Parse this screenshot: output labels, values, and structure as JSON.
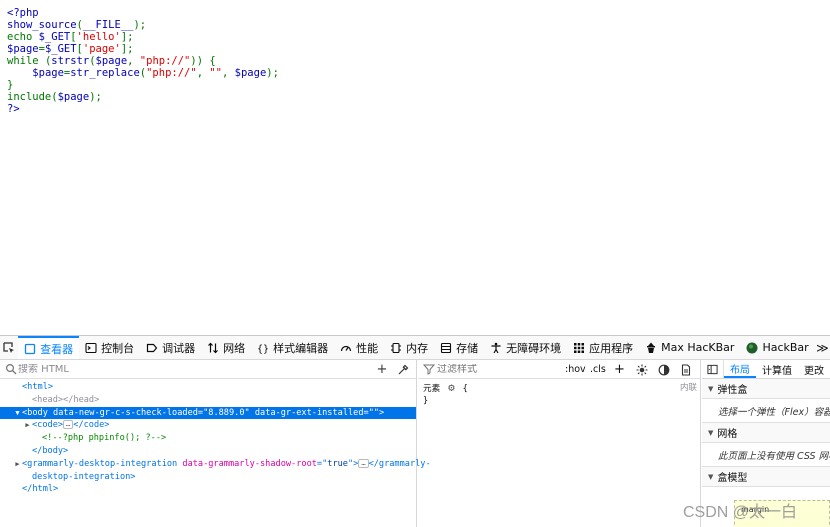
{
  "source": {
    "lines": [
      [
        {
          "t": "<?php",
          "c": "tag"
        }
      ],
      [
        {
          "t": "show_source",
          "c": "plain"
        },
        {
          "t": "(",
          "c": "op"
        },
        {
          "t": "__FILE__",
          "c": "plain"
        },
        {
          "t": ");",
          "c": "op"
        }
      ],
      [
        {
          "t": "echo ",
          "c": "op"
        },
        {
          "t": "$_GET",
          "c": "plain"
        },
        {
          "t": "[",
          "c": "op"
        },
        {
          "t": "'hello'",
          "c": "str"
        },
        {
          "t": "];",
          "c": "op"
        }
      ],
      [
        {
          "t": "$page",
          "c": "plain"
        },
        {
          "t": "=",
          "c": "op"
        },
        {
          "t": "$_GET",
          "c": "plain"
        },
        {
          "t": "[",
          "c": "op"
        },
        {
          "t": "'page'",
          "c": "str"
        },
        {
          "t": "];",
          "c": "op"
        }
      ],
      [
        {
          "t": "while ",
          "c": "op"
        },
        {
          "t": "(",
          "c": "op"
        },
        {
          "t": "strstr",
          "c": "plain"
        },
        {
          "t": "(",
          "c": "op"
        },
        {
          "t": "$page",
          "c": "plain"
        },
        {
          "t": ", ",
          "c": "op"
        },
        {
          "t": "\"php://\"",
          "c": "str"
        },
        {
          "t": ")) {",
          "c": "op"
        }
      ],
      [
        {
          "t": "    ",
          "c": "plain"
        },
        {
          "t": "$page",
          "c": "plain"
        },
        {
          "t": "=",
          "c": "op"
        },
        {
          "t": "str_replace",
          "c": "plain"
        },
        {
          "t": "(",
          "c": "op"
        },
        {
          "t": "\"php://\"",
          "c": "str"
        },
        {
          "t": ", ",
          "c": "op"
        },
        {
          "t": "\"\"",
          "c": "str"
        },
        {
          "t": ", ",
          "c": "op"
        },
        {
          "t": "$page",
          "c": "plain"
        },
        {
          "t": ");",
          "c": "op"
        }
      ],
      [
        {
          "t": "}",
          "c": "op"
        }
      ],
      [
        {
          "t": "include",
          "c": "op"
        },
        {
          "t": "(",
          "c": "op"
        },
        {
          "t": "$page",
          "c": "plain"
        },
        {
          "t": ");",
          "c": "op"
        }
      ],
      [
        {
          "t": "?>",
          "c": "tag"
        }
      ]
    ]
  },
  "toolbar": {
    "tabs": [
      {
        "id": "inspector",
        "label": "查看器",
        "icon": "inspector-icon",
        "active": true
      },
      {
        "id": "console",
        "label": "控制台",
        "icon": "console-icon"
      },
      {
        "id": "debugger",
        "label": "调试器",
        "icon": "debugger-icon"
      },
      {
        "id": "network",
        "label": "网络",
        "icon": "network-icon"
      },
      {
        "id": "style-editor",
        "label": "样式编辑器",
        "icon": "braces-icon"
      },
      {
        "id": "performance",
        "label": "性能",
        "icon": "gauge-icon"
      },
      {
        "id": "memory",
        "label": "内存",
        "icon": "memory-chip-icon"
      },
      {
        "id": "storage",
        "label": "存储",
        "icon": "storage-icon"
      },
      {
        "id": "accessibility",
        "label": "无障碍环境",
        "icon": "accessibility-icon"
      },
      {
        "id": "application",
        "label": "应用程序",
        "icon": "grid-icon"
      },
      {
        "id": "max-hackbar",
        "label": "Max HacKBar",
        "icon": "hacker-icon"
      },
      {
        "id": "hackbar",
        "label": "HackBar",
        "icon": "green-circle-icon"
      }
    ],
    "more_label": "≫"
  },
  "markup": {
    "search_placeholder": "搜索 HTML",
    "add_label": "+",
    "lines": [
      {
        "indent": 1,
        "twisty": "",
        "parts": [
          {
            "t": "<html>",
            "c": "tg"
          }
        ]
      },
      {
        "indent": 2,
        "twisty": "",
        "parts": [
          {
            "t": "<head>",
            "c": "dim"
          },
          {
            "t": "</head>",
            "c": "dim"
          }
        ]
      },
      {
        "indent": 1,
        "twisty": "▼",
        "selected": true,
        "parts": [
          {
            "t": "<body ",
            "c": "tg"
          },
          {
            "t": "data-new-gr-c-s-check-loaded",
            "c": "an"
          },
          {
            "t": "=\"",
            "c": "tg"
          },
          {
            "t": "8.889.0",
            "c": "av"
          },
          {
            "t": "\" ",
            "c": "tg"
          },
          {
            "t": "data-gr-ext-installed",
            "c": "an"
          },
          {
            "t": "=\"\">",
            "c": "tg"
          }
        ]
      },
      {
        "indent": 2,
        "twisty": "▶",
        "parts": [
          {
            "t": "<code>",
            "c": "tg"
          },
          {
            "t": "…",
            "c": "ell"
          },
          {
            "t": "</code>",
            "c": "tg"
          }
        ]
      },
      {
        "indent": 3,
        "twisty": "",
        "parts": [
          {
            "t": "<!--?php phpinfo(); ?-->",
            "c": "cm"
          }
        ]
      },
      {
        "indent": 2,
        "twisty": "",
        "parts": [
          {
            "t": "</body>",
            "c": "tg"
          }
        ]
      },
      {
        "indent": 1,
        "twisty": "▶",
        "parts": [
          {
            "t": "<grammarly-desktop-integration ",
            "c": "tg"
          },
          {
            "t": "data-grammarly-shadow-root",
            "c": "an"
          },
          {
            "t": "=\"",
            "c": "tg"
          },
          {
            "t": "true",
            "c": "av"
          },
          {
            "t": "\">",
            "c": "tg"
          },
          {
            "t": "…",
            "c": "ell"
          },
          {
            "t": "</grammarly-",
            "c": "tg"
          }
        ]
      },
      {
        "indent": 2,
        "twisty": "",
        "parts": [
          {
            "t": "desktop-integration>",
            "c": "tg"
          }
        ]
      },
      {
        "indent": 1,
        "twisty": "",
        "parts": [
          {
            "t": "</html>",
            "c": "tg"
          }
        ]
      }
    ]
  },
  "rules": {
    "filter_placeholder": "过滤样式",
    "hov_label": ":hov",
    "cls_label": ".cls",
    "add_label": "+",
    "element_label": "元素",
    "open_brace": "{",
    "close_brace": "}",
    "inline_label": "内联"
  },
  "sidebar": {
    "tabs": [
      {
        "label": "布局",
        "active": true
      },
      {
        "label": "计算值"
      },
      {
        "label": "更改"
      }
    ],
    "sections": [
      {
        "title": "弹性盒",
        "body": "选择一个弹性（Flex）容器"
      },
      {
        "title": "网格",
        "body": "此页面上没有使用 CSS 网格"
      },
      {
        "title": "盒模型",
        "body": ""
      }
    ],
    "box_label": "margin"
  },
  "watermark": "CSDN @太一白"
}
